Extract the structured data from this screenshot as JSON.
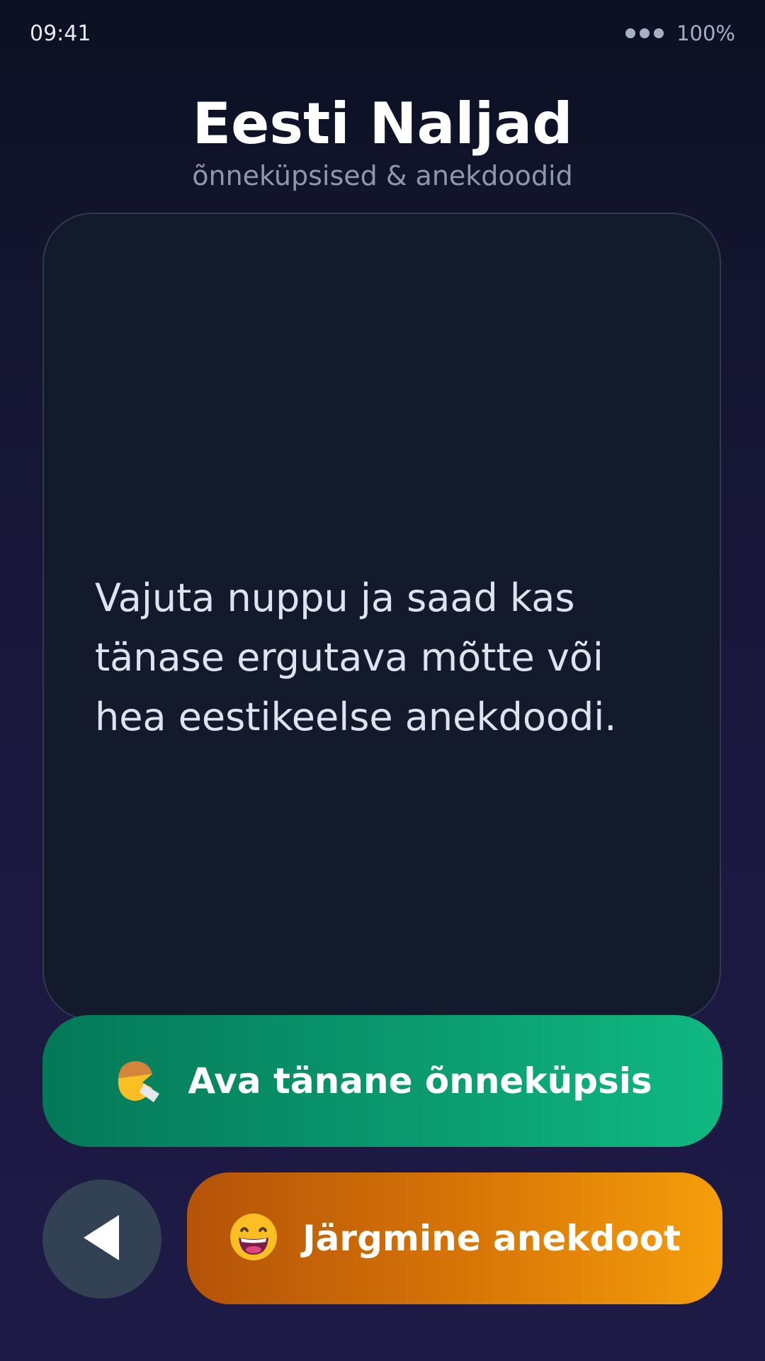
{
  "status_bar": {
    "time": "09:41",
    "battery": "100%",
    "signal_icon": "signal-dots-icon"
  },
  "header": {
    "title": "Eesti Naljad",
    "subtitle": "õnneküpsised & anekdoodid"
  },
  "card": {
    "text": "Vajuta nuppu ja saad kas tänase ergutava mõtte või hea eestikeelse anekdoodi."
  },
  "buttons": {
    "fortune": {
      "label": "Ava tänane õnneküpsis",
      "icon": "fortune-cookie-icon",
      "color_start": "#047857",
      "color_end": "#10b981"
    },
    "back": {
      "icon": "back-arrow-icon",
      "color": "#334155"
    },
    "next": {
      "label": "Järgmine anekdoot",
      "icon": "grinning-face-icon",
      "color_start": "#b45309",
      "color_end": "#f59e0b"
    }
  }
}
